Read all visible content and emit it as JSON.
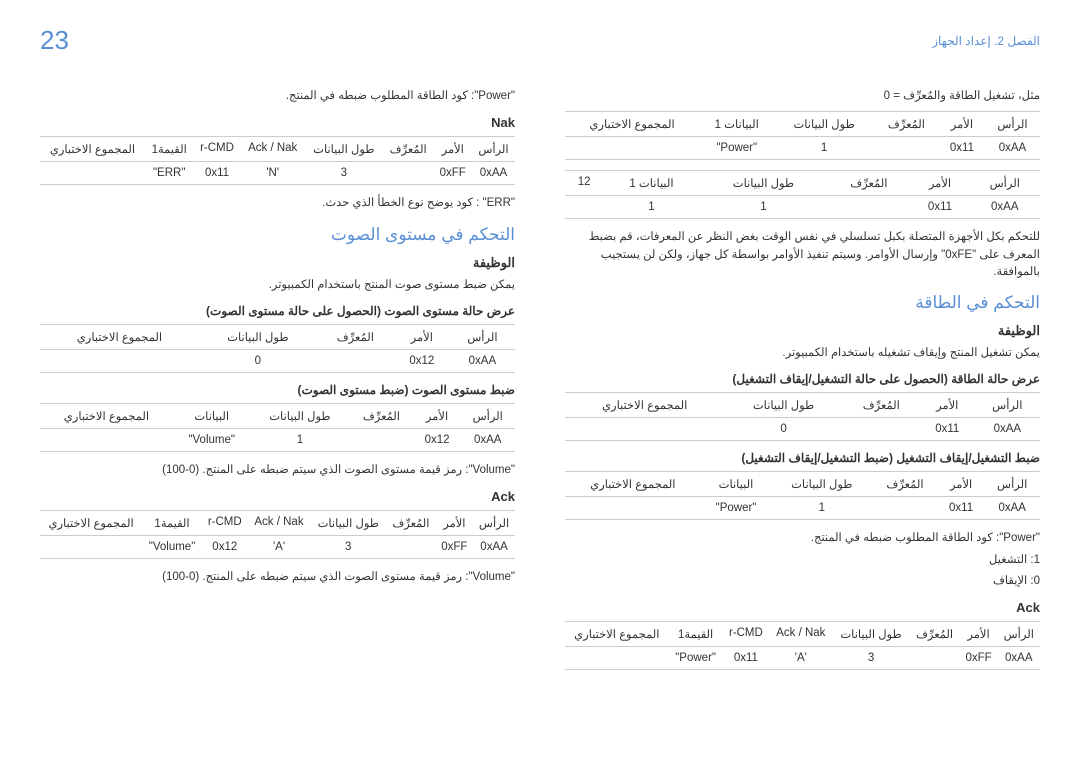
{
  "header": {
    "page_num": "23",
    "chapter": "الفصل 2. إعداد الجهاز"
  },
  "right": {
    "line1": "مثل، تشغيل الطاقة والمُعرِّف = 0",
    "t1_headers": [
      "الرأس",
      "الأمر",
      "المُعرِّف",
      "طول البيانات",
      "البيانات 1",
      "المجموع الاختباري"
    ],
    "t1_row": [
      "0xAA",
      "0x11",
      "",
      "1",
      "\"Power\"",
      ""
    ],
    "t2_headers": [
      "الرأس",
      "الأمر",
      "المُعرِّف",
      "طول البيانات",
      "البيانات 1",
      "12"
    ],
    "t2_row": [
      "0xAA",
      "0x11",
      "",
      "1",
      "1",
      ""
    ],
    "note1": "للتحكم بكل الأجهزة المتصلة بكبل تسلسلي في نفس الوقت بغض النظر عن المعرفات، قم بضبط المعرف على \"0xFE\" وإرسال الأوامر. وسيتم تنفيذ الأوامر بواسطة كل جهاز، ولكن لن يستجيب بالموافقة.",
    "h2_power": "التحكم في الطاقة",
    "h3_func": "الوظيفة",
    "func_desc": "يمكن تشغيل المنتج وإيقاف تشغيله باستخدام الكمبيوتر.",
    "h4_view": "عرض حالة الطاقة (الحصول على حالة التشغيل/إيقاف التشغيل)",
    "t3_headers": [
      "الرأس",
      "الأمر",
      "المُعرِّف",
      "طول البيانات",
      "المجموع الاختباري"
    ],
    "t3_row": [
      "0xAA",
      "0x11",
      "",
      "0",
      ""
    ],
    "h4_set": "ضبط التشغيل/إيقاف التشغيل (ضبط التشغيل/إيقاف التشغيل)",
    "t4_headers": [
      "الرأس",
      "الأمر",
      "المُعرِّف",
      "طول البيانات",
      "البيانات",
      "المجموع الاختباري"
    ],
    "t4_row": [
      "0xAA",
      "0x11",
      "",
      "1",
      "\"Power\"",
      ""
    ],
    "power_code": "\"Power\": كود الطاقة المطلوب ضبطه في المنتج.",
    "on": "1: التشغيل",
    "off": "0: الإيقاف",
    "h3_ack": "Ack",
    "t5_headers": [
      "الرأس",
      "الأمر",
      "المُعرِّف",
      "طول البيانات",
      "Ack / Nak",
      "r-CMD",
      "القيمة1",
      "المجموع الاختباري"
    ],
    "t5_row": [
      "0xAA",
      "0xFF",
      "",
      "3",
      "'A'",
      "0x11",
      "\"Power\"",
      ""
    ]
  },
  "left": {
    "power_code": "\"Power\": كود الطاقة المطلوب ضبطه في المنتج.",
    "h3_nak": "Nak",
    "t1_headers": [
      "الرأس",
      "الأمر",
      "المُعرِّف",
      "طول البيانات",
      "Ack / Nak",
      "r-CMD",
      "القيمة1",
      "المجموع الاختباري"
    ],
    "t1_row": [
      "0xAA",
      "0xFF",
      "",
      "3",
      "'N'",
      "0x11",
      "\"ERR\"",
      ""
    ],
    "err_desc": "\"ERR\" : كود يوضح نوع الخطأ الذي حدث.",
    "h2_vol": "التحكم في مستوى الصوت",
    "h3_func": "الوظيفة",
    "func_desc": "يمكن ضبط مستوى صوت المنتج باستخدام الكمبيوتر.",
    "h4_view": "عرض حالة مستوى الصوت (الحصول على حالة مستوى الصوت)",
    "t2_headers": [
      "الرأس",
      "الأمر",
      "المُعرِّف",
      "طول البيانات",
      "المجموع الاختباري"
    ],
    "t2_row": [
      "0xAA",
      "0x12",
      "",
      "0",
      ""
    ],
    "h4_set": "ضبط مستوى الصوت (ضبط مستوى الصوت)",
    "t3_headers": [
      "الرأس",
      "الأمر",
      "المُعرِّف",
      "طول البيانات",
      "البيانات",
      "المجموع الاختباري"
    ],
    "t3_row": [
      "0xAA",
      "0x12",
      "",
      "1",
      "\"Volume\"",
      ""
    ],
    "vol_desc": "\"Volume\": رمز قيمة مستوى الصوت الذي سيتم ضبطه على المنتج. (0-100)",
    "h3_ack": "Ack",
    "t4_headers": [
      "الرأس",
      "الأمر",
      "المُعرِّف",
      "طول البيانات",
      "Ack / Nak",
      "r-CMD",
      "القيمة1",
      "المجموع الاختباري"
    ],
    "t4_row": [
      "0xAA",
      "0xFF",
      "",
      "3",
      "'A'",
      "0x12",
      "\"Volume\"",
      ""
    ],
    "vol_desc2": "\"Volume\": رمز قيمة مستوى الصوت الذي سيتم ضبطه على المنتج. (0-100)"
  }
}
